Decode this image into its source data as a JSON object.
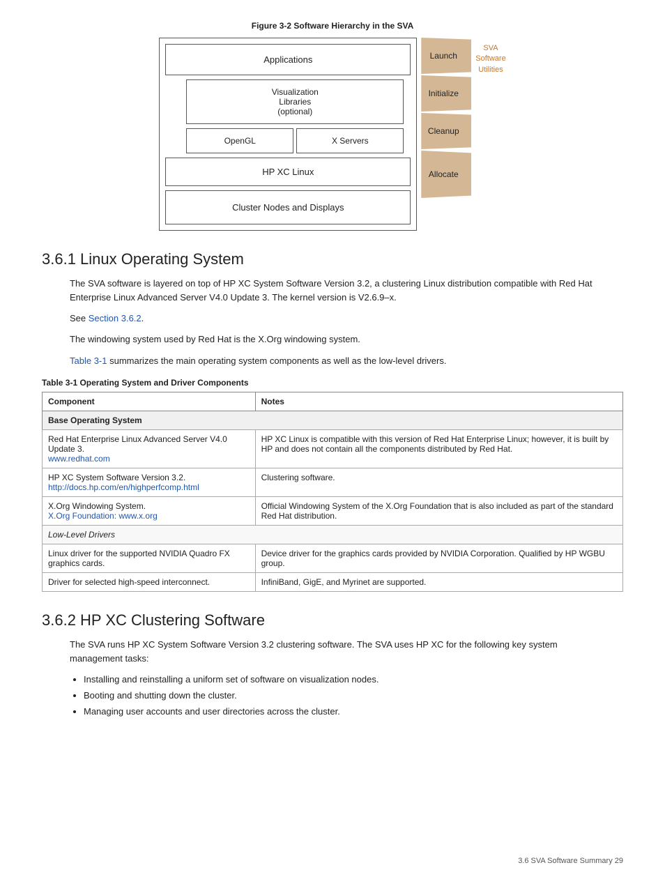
{
  "figure": {
    "title": "Figure  3-2  Software Hierarchy in the SVA",
    "layers": {
      "applications": "Applications",
      "viz": "Visualization\nLibraries\n(optional)",
      "opengl": "OpenGL",
      "xservers": "X Servers",
      "hpxclinux": "HP XC Linux",
      "cluster": "Cluster Nodes and Displays"
    },
    "trapezoid_labels": [
      "Launch",
      "Initialize",
      "Cleanup",
      "Allocate"
    ],
    "sva_label": "SVA\nSoftware\nUtilities"
  },
  "section361": {
    "heading": "3.6.1  Linux Operating System",
    "paragraphs": [
      "The SVA software is layered on top of HP XC System Software Version 3.2, a clustering Linux distribution compatible with Red Hat Enterprise Linux Advanced Server V4.0 Update 3. The kernel version is V2.6.9–x.",
      "See Section 3.6.2.",
      "The windowing system used by Red Hat is the X.Org windowing system.",
      "Table 3-1 summarizes the main operating system components as well as the low-level drivers."
    ],
    "see_link": "Section 3.6.2",
    "table_ref": "Table 3-1"
  },
  "table": {
    "title": "Table  3-1  Operating System and Driver Components",
    "headers": [
      "Component",
      "Notes"
    ],
    "section_base": "Base Operating System",
    "section_lowlevel": "Low-Level Drivers",
    "rows": [
      {
        "component": "Red Hat Enterprise Linux Advanced Server V4.0 Update 3.\nwww.redhat.com",
        "component_link": "www.redhat.com",
        "notes": "HP XC Linux is compatible with this version of Red Hat Enterprise Linux; however, it is built by HP and does not contain all the components distributed by Red Hat."
      },
      {
        "component": "HP XC System Software Version 3.2.\nhttp://docs.hp.com/en/highperfcomp.html",
        "component_link": "http://docs.hp.com/en/highperfcomp.html",
        "notes": "Clustering software."
      },
      {
        "component": "X.Org Windowing System.\nX.Org Foundation: www.x.org",
        "component_link": "X.Org Foundation: www.x.org",
        "notes": "Official Windowing System of the X.Org Foundation that is also included as part of the standard Red Hat distribution."
      },
      {
        "component": "Linux driver for the supported NVIDIA Quadro FX graphics cards.",
        "notes": "Device driver for the graphics cards provided by NVIDIA Corporation. Qualified by HP WGBU group."
      },
      {
        "component": "Driver for selected high-speed interconnect.",
        "notes": "InfiniBand, GigE, and Myrinet are supported."
      }
    ]
  },
  "section362": {
    "heading": "3.6.2  HP XC Clustering Software",
    "paragraph": "The SVA runs HP XC System Software Version 3.2 clustering software. The SVA uses HP XC for the following key system management tasks:",
    "bullets": [
      "Installing and reinstalling a uniform set of software on visualization nodes.",
      "Booting and shutting down the cluster.",
      "Managing user accounts and user directories across the cluster."
    ]
  },
  "footer": {
    "text": "3.6 SVA Software Summary    29"
  }
}
